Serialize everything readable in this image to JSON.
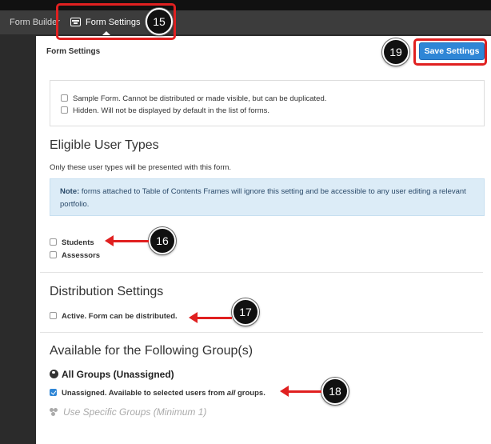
{
  "nav": {
    "form_builder": "Form Builder",
    "form_settings": "Form Settings"
  },
  "page": {
    "title": "Form Settings",
    "save_button": "Save Settings"
  },
  "options": {
    "sample_form": "Sample Form. Cannot be distributed or made visible, but can be duplicated.",
    "hidden": "Hidden. Will not be displayed by default in the list of forms."
  },
  "eligible": {
    "heading": "Eligible User Types",
    "subtitle": "Only these user types will be presented with this form.",
    "note_label": "Note:",
    "note_text": " forms attached to Table of Contents Frames will ignore this setting and be accessible to any user editing a relevant portfolio.",
    "students": "Students",
    "assessors": "Assessors"
  },
  "distribution": {
    "heading": "Distribution Settings",
    "active": "Active. Form can be distributed."
  },
  "groups": {
    "heading": "Available for the Following Group(s)",
    "all_groups": "All Groups (Unassigned)",
    "unassigned_prefix": "Unassigned. Available to selected users from ",
    "unassigned_em": "all",
    "unassigned_suffix": " groups.",
    "use_specific": "Use Specific Groups (Minimum 1)"
  },
  "callouts": {
    "c15": "15",
    "c16": "16",
    "c17": "17",
    "c18": "18",
    "c19": "19"
  },
  "colors": {
    "accent": "#2f86d6",
    "callout_red": "#e02020"
  }
}
